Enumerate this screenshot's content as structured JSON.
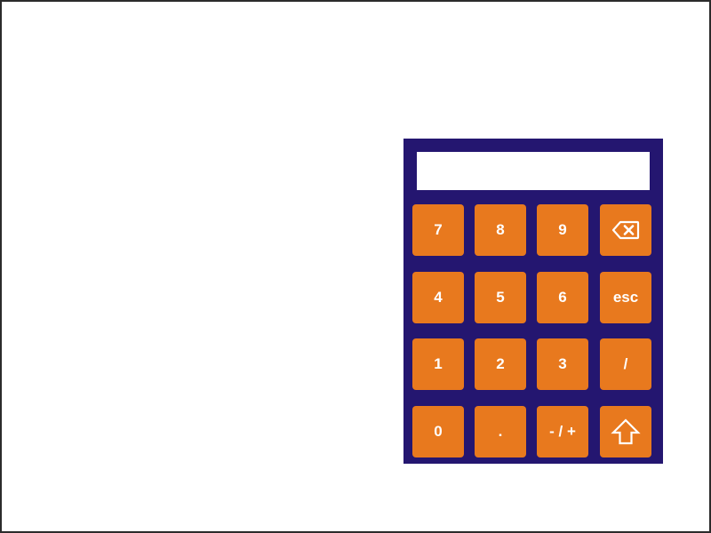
{
  "keypad": {
    "display_value": "",
    "colors": {
      "background": "#241670",
      "key": "#e8791e",
      "key_text": "#ffffff",
      "display": "#ffffff"
    },
    "rows": [
      [
        {
          "label": "7"
        },
        {
          "label": "8"
        },
        {
          "label": "9"
        },
        {
          "icon": "backspace-icon"
        }
      ],
      [
        {
          "label": "4"
        },
        {
          "label": "5"
        },
        {
          "label": "6"
        },
        {
          "label": "esc"
        }
      ],
      [
        {
          "label": "1"
        },
        {
          "label": "2"
        },
        {
          "label": "3"
        },
        {
          "label": "/"
        }
      ],
      [
        {
          "label": "0"
        },
        {
          "label": "."
        },
        {
          "label": "- / +"
        },
        {
          "icon": "shift-arrow-up-icon"
        }
      ]
    ]
  }
}
